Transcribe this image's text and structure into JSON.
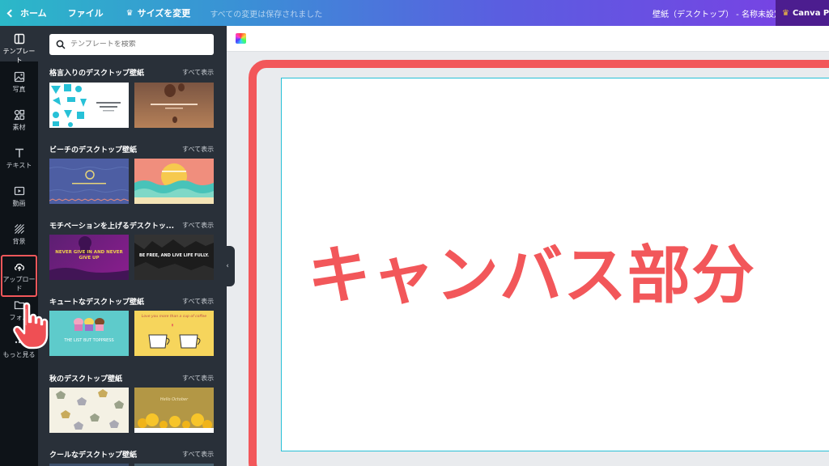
{
  "topbar": {
    "home": "ホーム",
    "file": "ファイル",
    "resize": "サイズを変更",
    "saved_status": "すべての変更は保存されました",
    "doc_title": "壁紙（デスクトップ） - 名称未設定",
    "pro": "Canva Pro"
  },
  "rail": {
    "items": [
      {
        "label": "テンプレート",
        "icon": "template-icon"
      },
      {
        "label": "写真",
        "icon": "photo-icon"
      },
      {
        "label": "素材",
        "icon": "elements-icon"
      },
      {
        "label": "テキスト",
        "icon": "text-icon"
      },
      {
        "label": "動画",
        "icon": "video-icon"
      },
      {
        "label": "背景",
        "icon": "background-icon"
      },
      {
        "label": "アップロード",
        "icon": "upload-icon"
      },
      {
        "label": "フォル",
        "icon": "folder-icon"
      },
      {
        "label": "もっと見る",
        "icon": "more-icon"
      }
    ]
  },
  "panel": {
    "search_placeholder": "テンプレートを検索",
    "see_all": "すべて表示",
    "sections": [
      {
        "title": "格言入りのデスクトップ壁紙"
      },
      {
        "title": "ビーチのデスクトップ壁紙"
      },
      {
        "title": "モチベーションを上げるデスクトッ..."
      },
      {
        "title": "キュートなデスクトップ壁紙"
      },
      {
        "title": "秋のデスクトップ壁紙"
      },
      {
        "title": "クールなデスクトップ壁紙"
      }
    ],
    "thumbnails": {
      "quote_2": "Dream big and dare to fail.",
      "beach_1": "Somewhere Only We Know",
      "motiv_1": "NEVER GIVE IN AND NEVER GIVE UP",
      "motiv_2": "BE FREE, AND LIVE LIFE FULLY.",
      "cute_1": "THE LIST BUT TOPPRESS",
      "cute_2": "Love you more than a cup of coffee",
      "autumn_2": "Hello October"
    }
  },
  "canvas": {
    "label": "キャンバス部分"
  },
  "colors": {
    "accent_red": "#f2575a",
    "canvas_border": "#27c1d7",
    "panel_bg": "#293039",
    "rail_bg": "#0e1318"
  }
}
